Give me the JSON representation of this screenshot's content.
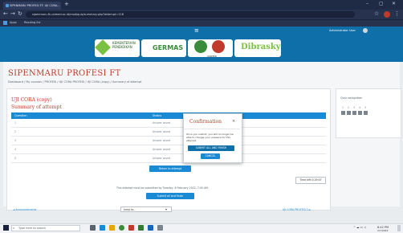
{
  "browser": {
    "tab_title": "SIPENMARU PROFESI FT: UJI CORA...",
    "new_tab": "+",
    "url": "sipenmaru.ft.unimed.ac.id/mod/quiz/summary.php?attempt=118",
    "bookmarks": [
      "Apps",
      "Reading list"
    ],
    "window_controls": [
      "–",
      "▢",
      "✕"
    ]
  },
  "header": {
    "menu_icon": "hamburger-icon",
    "user_name": "Administrator User",
    "logos": [
      "KEMENTERIAN PENDIDIKAN",
      "GERMAS",
      "UNIMED",
      "Dibrasky"
    ]
  },
  "page": {
    "title": "SIPENMARU PROFESI FT",
    "breadcrumb": "Dashboard / My courses / PROFESI / UJI CORA PROFESI / UJI CORA (copy) / Summary of attempt",
    "quiz_title": "UJI CORA (copy)",
    "summary_title": "Summary of attempt",
    "table": {
      "headers": [
        "Question",
        "Status"
      ],
      "rows": [
        {
          "q": "1",
          "status": "Answer saved"
        },
        {
          "q": "2",
          "status": "Answer saved"
        },
        {
          "q": "3",
          "status": "Answer saved"
        },
        {
          "q": "4",
          "status": "Answer saved"
        },
        {
          "q": "5",
          "status": "Answer saved"
        }
      ]
    },
    "return_button": "Return to attempt",
    "time_left": "Time left 0:29:07",
    "note": "This attempt must be submitted by Tuesday, 8 February 2022, 7:00 AM.",
    "submit_button": "Submit all and finish",
    "prev_link": "◄ Announcements",
    "jump_label": "Jump to...",
    "next_link": "UJI CORA PROFESI 2 ►"
  },
  "sidebar": {
    "title": "Quiz navigation",
    "nums": [
      "1",
      "2",
      "3",
      "4",
      "5"
    ]
  },
  "modal": {
    "title": "Confirmation",
    "close": "×",
    "body": "Once you submit, you will no longer be able to change your answers for this attempt.",
    "confirm_button": "SUBMIT ALL AND FINISH",
    "cancel_button": "CANCEL"
  },
  "taskbar": {
    "search_placeholder": "Type here to search",
    "time": "6:42 PM",
    "date": "2/7/2022"
  },
  "colors": {
    "primary": "#1a8ad4",
    "header": "#0f6fa8",
    "accent_red": "#c0392b"
  }
}
